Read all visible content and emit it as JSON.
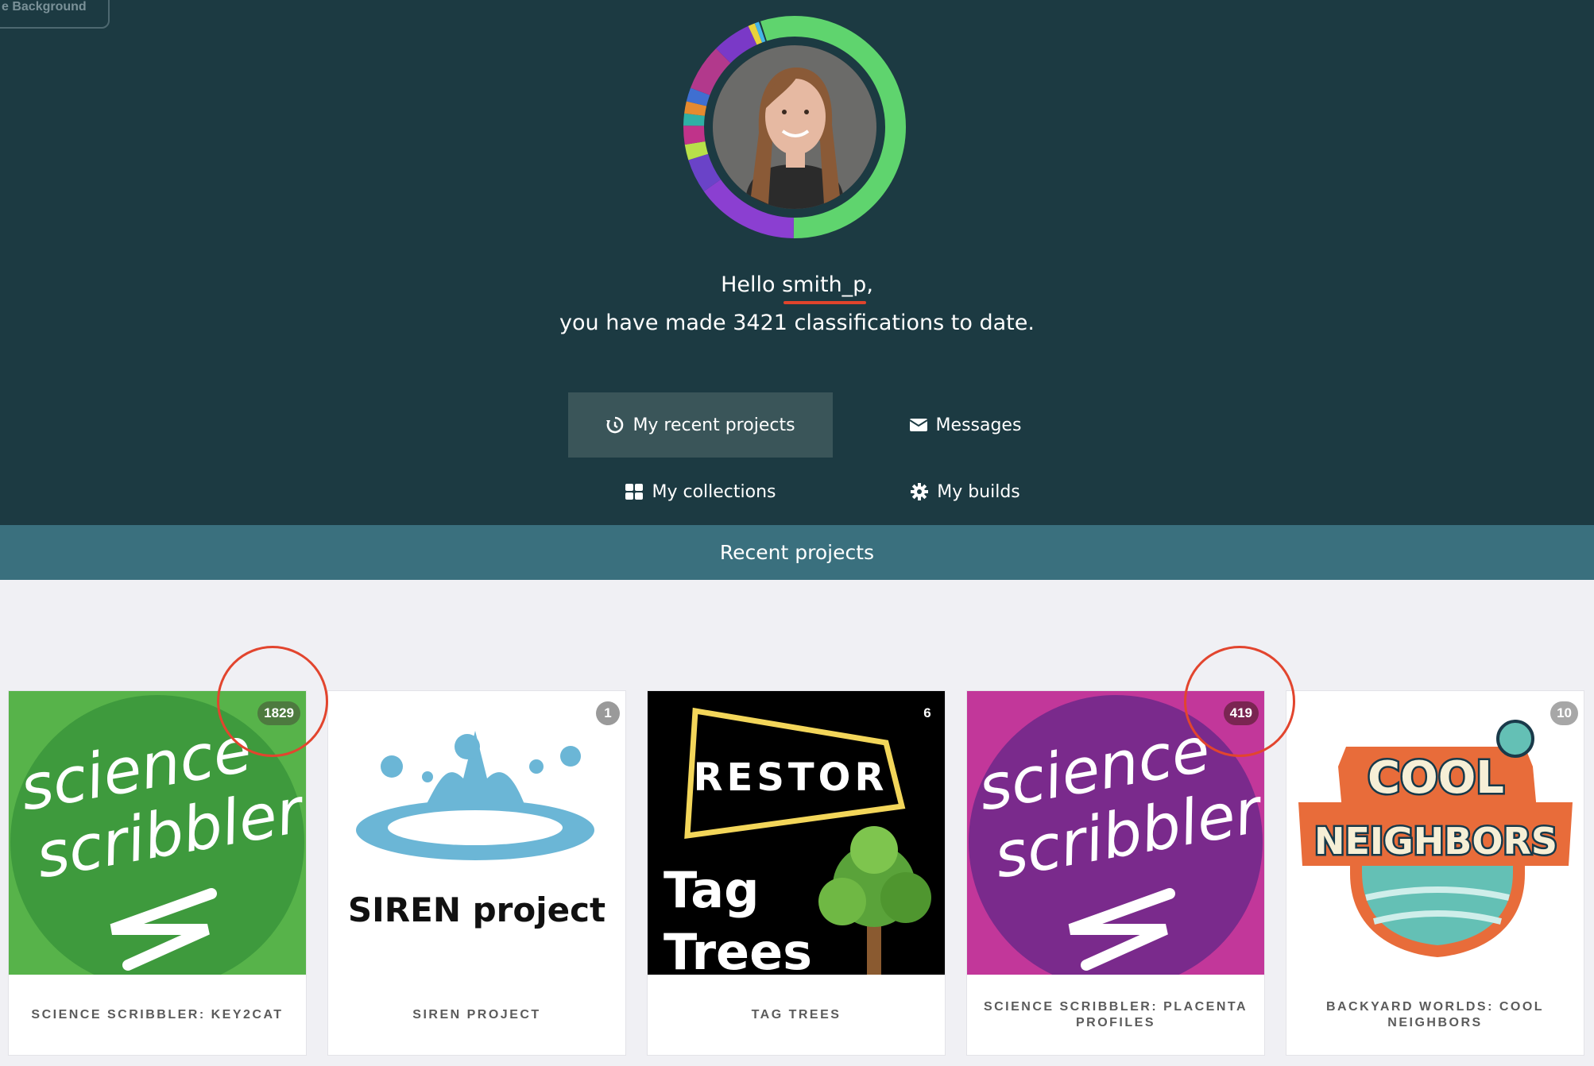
{
  "header": {
    "background_button": "e Background",
    "greeting_prefix": "Hello ",
    "username": "smith_p",
    "greeting_suffix": ",",
    "classifications_line": "you have made 3421 classifications to date."
  },
  "nav": {
    "recent": "My recent projects",
    "messages": "Messages",
    "collections": "My collections",
    "builds": "My builds"
  },
  "section_title": "Recent projects",
  "projects": [
    {
      "title": "SCIENCE SCRIBBLER: KEY2CAT",
      "count": "1829"
    },
    {
      "title": "SIREN PROJECT",
      "count": "1",
      "image_text": "SIREN project"
    },
    {
      "title": "TAG TREES",
      "count": "6",
      "image_text_1": "RESTOR",
      "image_text_2": "Tag",
      "image_text_3": "Trees"
    },
    {
      "title": "SCIENCE SCRIBBLER: PLACENTA PROFILES",
      "count": "419"
    },
    {
      "title": "BACKYARD WORLDS: COOL NEIGHBORS",
      "count": "10"
    }
  ],
  "colors": {
    "hero_bg": "#1c3a42",
    "section_bar": "#3a707e",
    "active_nav": "#3a5559",
    "annotation_red": "#e2452e"
  },
  "icons": [
    "history-icon",
    "envelope-icon",
    "grid-icon",
    "gear-icon"
  ]
}
